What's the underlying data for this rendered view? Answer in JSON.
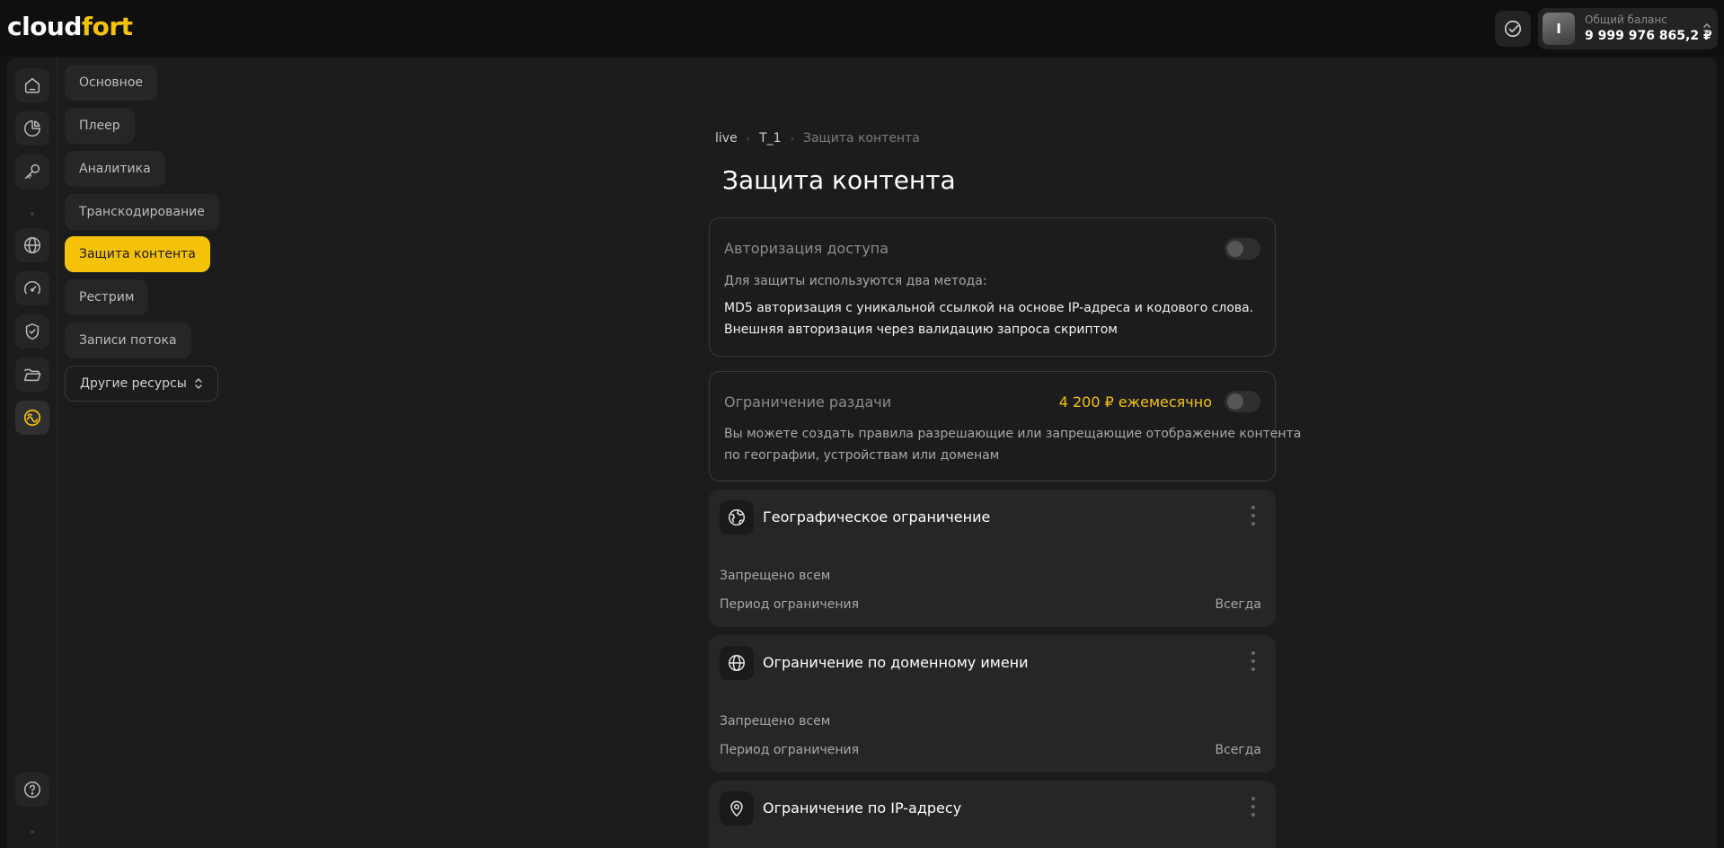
{
  "header": {
    "logo_main": "cloud",
    "logo_accent": "fort",
    "avatar_initial": "I",
    "balance_label": "Общий баланс",
    "balance_value": "9 999 976 865,2 ₽",
    "icons": [
      "check-circle-icon",
      "chevron-updown-icon"
    ]
  },
  "sidebar": {
    "icons": [
      "home-icon",
      "pie-chart-icon",
      "key-icon",
      "globe-icon",
      "speedometer-icon",
      "shield-check-icon",
      "folder-open-icon",
      "stream-icon",
      "help-icon"
    ],
    "active_icon": "stream-icon"
  },
  "submenu": {
    "items": [
      "Основное",
      "Плеер",
      "Аналитика",
      "Транскодирование",
      "Защита контента",
      "Рестрим",
      "Записи потока"
    ],
    "active": "Защита контента",
    "more_label": "Другие ресурсы"
  },
  "breadcrumb": {
    "items": [
      "live",
      "T_1",
      "Защита контента"
    ]
  },
  "page": {
    "title": "Защита контента"
  },
  "auth_card": {
    "title": "Авторизация доступа",
    "enabled": false,
    "intro": "Для защиты используются два метода:",
    "method1": "MD5 авторизация с уникальной ссылкой на основе IP-адреса и кодового слова.",
    "method2": "Внешняя авторизация через валидацию запроса скриптом"
  },
  "limit_card": {
    "title": "Ограничение раздачи",
    "price": "4 200 ₽ ежемесячно",
    "enabled": false,
    "desc_line1": "Вы можете создать правила разрешающие или запрещающие отображение контента",
    "desc_line2": "по географии, устройствам или доменам"
  },
  "rules": [
    {
      "icon": "geo-globe-icon",
      "title": "Географическое ограничение",
      "status": "Запрещено всем",
      "period_label": "Период ограничения",
      "period_value": "Всегда"
    },
    {
      "icon": "globe-icon",
      "title": "Ограничение по доменному имени",
      "status": "Запрещено всем",
      "period_label": "Период ограничения",
      "period_value": "Всегда"
    },
    {
      "icon": "location-pin-icon",
      "title": "Ограничение по IP-адресу",
      "status": "",
      "period_label": "",
      "period_value": ""
    }
  ],
  "colors": {
    "accent": "#f5c20a",
    "background": "#121212",
    "panel": "#1c1c1e",
    "card": "#262628"
  }
}
